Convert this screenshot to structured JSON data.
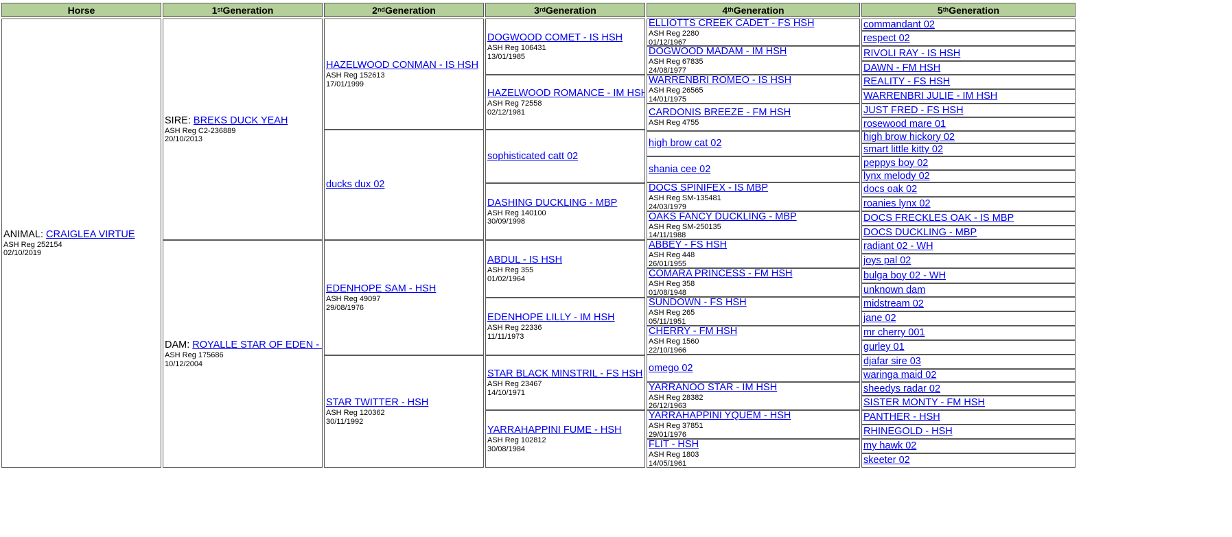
{
  "headers": [
    {
      "base": "Horse",
      "sup": "",
      "rest": ""
    },
    {
      "base": "1",
      "sup": "st",
      "rest": " Generation"
    },
    {
      "base": "2",
      "sup": "nd",
      "rest": " Generation"
    },
    {
      "base": "3",
      "sup": "rd",
      "rest": " Generation"
    },
    {
      "base": "4",
      "sup": "th",
      "rest": " Generation"
    },
    {
      "base": "5",
      "sup": "th",
      "rest": " Generation"
    }
  ],
  "horse": {
    "prefix": "ANIMAL: ",
    "name": "CRAIGLEA VIRTUE",
    "reg": "ASH Reg 252154",
    "date": "02/10/2019"
  },
  "gen1": [
    {
      "prefix": "SIRE: ",
      "name": "BREKS DUCK YEAH",
      "reg": "ASH Reg C2-236889",
      "date": "20/10/2013"
    },
    {
      "prefix": "DAM: ",
      "name": "ROYALLE STAR OF EDEN - HSH",
      "reg": "ASH Reg 175686",
      "date": "10/12/2004"
    }
  ],
  "gen2": [
    {
      "name": "HAZELWOOD CONMAN - IS HSH",
      "reg": "ASH Reg 152613",
      "date": "17/01/1999"
    },
    {
      "name": "ducks dux 02",
      "reg": "",
      "date": ""
    },
    {
      "name": "EDENHOPE SAM - HSH",
      "reg": "ASH Reg 49097",
      "date": "29/08/1976"
    },
    {
      "name": "STAR TWITTER - HSH",
      "reg": "ASH Reg 120362",
      "date": "30/11/1992"
    }
  ],
  "gen3": [
    {
      "name": "DOGWOOD COMET - IS HSH",
      "reg": "ASH Reg 106431",
      "date": "13/01/1985"
    },
    {
      "name": "HAZELWOOD ROMANCE - IM HSH",
      "reg": "ASH Reg 72558",
      "date": "02/12/1981"
    },
    {
      "name": "sophisticated catt 02",
      "reg": "",
      "date": ""
    },
    {
      "name": "DASHING DUCKLING - MBP",
      "reg": "ASH Reg 140100",
      "date": "30/09/1998"
    },
    {
      "name": "ABDUL - IS HSH",
      "reg": "ASH Reg 355",
      "date": "01/02/1964"
    },
    {
      "name": "EDENHOPE LILLY - IM HSH",
      "reg": "ASH Reg 22336",
      "date": "11/11/1973"
    },
    {
      "name": "STAR BLACK MINSTRIL - FS HSH",
      "reg": "ASH Reg 23467",
      "date": "14/10/1971"
    },
    {
      "name": "YARRAHAPPINI FUME - HSH",
      "reg": "ASH Reg 102812",
      "date": "30/08/1984"
    }
  ],
  "gen4": [
    {
      "name": "ELLIOTTS CREEK CADET - FS HSH",
      "reg": "ASH Reg 2280",
      "date": "01/12/1967"
    },
    {
      "name": "DOGWOOD MADAM - IM HSH",
      "reg": "ASH Reg 67835",
      "date": "24/08/1977"
    },
    {
      "name": "WARRENBRI ROMEO - IS HSH",
      "reg": "ASH Reg 26565",
      "date": "14/01/1975"
    },
    {
      "name": "CARDONIS BREEZE - FM HSH",
      "reg": "ASH Reg 4755",
      "date": ""
    },
    {
      "name": "high brow cat 02",
      "reg": "",
      "date": ""
    },
    {
      "name": "shania cee 02",
      "reg": "",
      "date": ""
    },
    {
      "name": "DOCS SPINIFEX - IS MBP",
      "reg": "ASH Reg SM-135481",
      "date": "24/03/1979"
    },
    {
      "name": "OAKS FANCY DUCKLING - MBP",
      "reg": "ASH Reg SM-250135",
      "date": "14/11/1988"
    },
    {
      "name": "ABBEY - FS HSH",
      "reg": "ASH Reg 448",
      "date": "26/01/1955"
    },
    {
      "name": "COMARA PRINCESS - FM HSH",
      "reg": "ASH Reg 358",
      "date": "01/08/1948"
    },
    {
      "name": "SUNDOWN - FS HSH",
      "reg": "ASH Reg 265",
      "date": "05/11/1951"
    },
    {
      "name": "CHERRY - FM HSH",
      "reg": "ASH Reg 1560",
      "date": "22/10/1966"
    },
    {
      "name": "omego 02",
      "reg": "",
      "date": ""
    },
    {
      "name": "YARRANOO STAR - IM HSH",
      "reg": "ASH Reg 28382",
      "date": "26/12/1963"
    },
    {
      "name": "YARRAHAPPINI YQUEM - HSH",
      "reg": "ASH Reg 37851",
      "date": "29/01/1976"
    },
    {
      "name": "FLIT - HSH",
      "reg": "ASH Reg 1803",
      "date": "14/05/1961"
    }
  ],
  "gen5": [
    "commandant 02",
    "respect 02",
    "RIVOLI RAY - IS HSH",
    "DAWN - FM HSH",
    "REALITY - FS HSH",
    "WARRENBRI JULIE - IM HSH",
    "JUST FRED - FS HSH",
    "rosewood mare 01",
    "high brow hickory 02",
    "smart little kitty 02",
    "peppys boy 02",
    "lynx melody 02",
    "docs oak 02",
    "roanies lynx 02",
    "DOCS FRECKLES OAK - IS MBP",
    "DOCS DUCKLING - MBP",
    "radiant 02 - WH",
    "joys pal 02",
    "bulga boy 02 - WH",
    "unknown dam",
    "midstream 02",
    "jane 02",
    "mr cherry 001",
    "gurley 01",
    "djafar sire 03",
    "waringa maid 02",
    "sheedys radar 02",
    "SISTER MONTY - FM HSH",
    "PANTHER - HSH",
    "RHINEGOLD - HSH",
    "my hawk 02",
    "skeeter 02"
  ]
}
